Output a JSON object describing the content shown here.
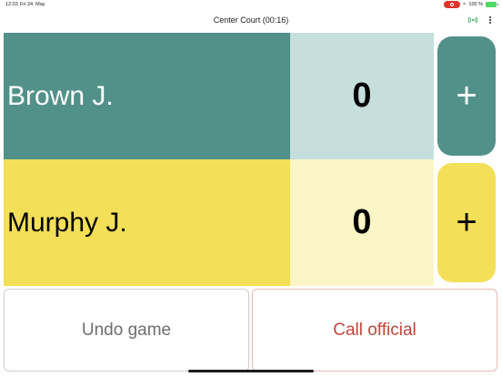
{
  "status_bar": {
    "time": "12:03",
    "date": "Fri 24. May",
    "battery_text": "100 %"
  },
  "header": {
    "title": "Center Court (00:16)"
  },
  "players": [
    {
      "name": "Brown J.",
      "score": "0",
      "add_label": "+",
      "color": "#52918a",
      "score_bg": "#c6dfdc"
    },
    {
      "name": "Murphy J.",
      "score": "0",
      "add_label": "+",
      "color": "#f4df58",
      "score_bg": "#fbf6c6"
    }
  ],
  "actions": {
    "undo_label": "Undo game",
    "call_official_label": "Call official"
  },
  "icons": {
    "recording": "record-icon",
    "broadcast": "broadcast-icon",
    "menu": "more-vertical-icon"
  },
  "colors": {
    "call_official_text": "#c2453d"
  }
}
